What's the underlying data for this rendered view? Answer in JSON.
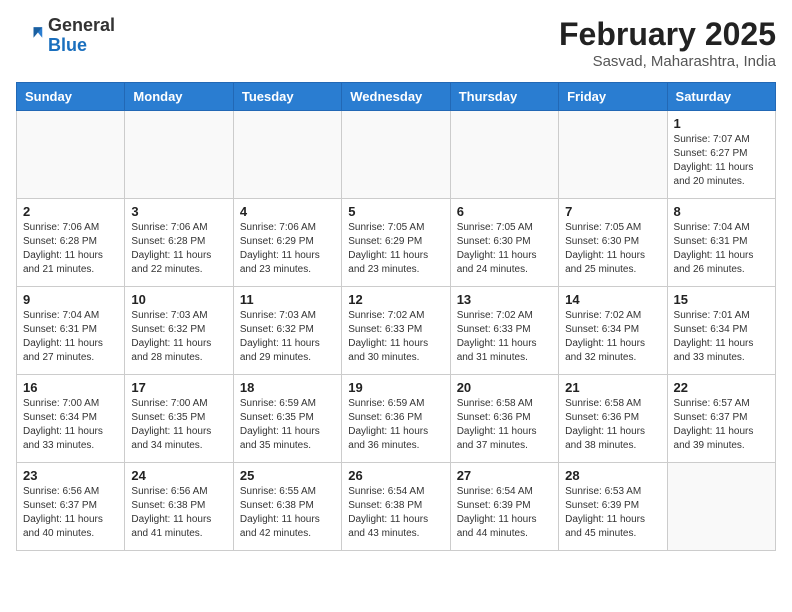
{
  "header": {
    "logo_general": "General",
    "logo_blue": "Blue",
    "month": "February 2025",
    "location": "Sasvad, Maharashtra, India"
  },
  "weekdays": [
    "Sunday",
    "Monday",
    "Tuesday",
    "Wednesday",
    "Thursday",
    "Friday",
    "Saturday"
  ],
  "weeks": [
    [
      {
        "day": "",
        "info": ""
      },
      {
        "day": "",
        "info": ""
      },
      {
        "day": "",
        "info": ""
      },
      {
        "day": "",
        "info": ""
      },
      {
        "day": "",
        "info": ""
      },
      {
        "day": "",
        "info": ""
      },
      {
        "day": "1",
        "info": "Sunrise: 7:07 AM\nSunset: 6:27 PM\nDaylight: 11 hours and 20 minutes."
      }
    ],
    [
      {
        "day": "2",
        "info": "Sunrise: 7:06 AM\nSunset: 6:28 PM\nDaylight: 11 hours and 21 minutes."
      },
      {
        "day": "3",
        "info": "Sunrise: 7:06 AM\nSunset: 6:28 PM\nDaylight: 11 hours and 22 minutes."
      },
      {
        "day": "4",
        "info": "Sunrise: 7:06 AM\nSunset: 6:29 PM\nDaylight: 11 hours and 23 minutes."
      },
      {
        "day": "5",
        "info": "Sunrise: 7:05 AM\nSunset: 6:29 PM\nDaylight: 11 hours and 23 minutes."
      },
      {
        "day": "6",
        "info": "Sunrise: 7:05 AM\nSunset: 6:30 PM\nDaylight: 11 hours and 24 minutes."
      },
      {
        "day": "7",
        "info": "Sunrise: 7:05 AM\nSunset: 6:30 PM\nDaylight: 11 hours and 25 minutes."
      },
      {
        "day": "8",
        "info": "Sunrise: 7:04 AM\nSunset: 6:31 PM\nDaylight: 11 hours and 26 minutes."
      }
    ],
    [
      {
        "day": "9",
        "info": "Sunrise: 7:04 AM\nSunset: 6:31 PM\nDaylight: 11 hours and 27 minutes."
      },
      {
        "day": "10",
        "info": "Sunrise: 7:03 AM\nSunset: 6:32 PM\nDaylight: 11 hours and 28 minutes."
      },
      {
        "day": "11",
        "info": "Sunrise: 7:03 AM\nSunset: 6:32 PM\nDaylight: 11 hours and 29 minutes."
      },
      {
        "day": "12",
        "info": "Sunrise: 7:02 AM\nSunset: 6:33 PM\nDaylight: 11 hours and 30 minutes."
      },
      {
        "day": "13",
        "info": "Sunrise: 7:02 AM\nSunset: 6:33 PM\nDaylight: 11 hours and 31 minutes."
      },
      {
        "day": "14",
        "info": "Sunrise: 7:02 AM\nSunset: 6:34 PM\nDaylight: 11 hours and 32 minutes."
      },
      {
        "day": "15",
        "info": "Sunrise: 7:01 AM\nSunset: 6:34 PM\nDaylight: 11 hours and 33 minutes."
      }
    ],
    [
      {
        "day": "16",
        "info": "Sunrise: 7:00 AM\nSunset: 6:34 PM\nDaylight: 11 hours and 33 minutes."
      },
      {
        "day": "17",
        "info": "Sunrise: 7:00 AM\nSunset: 6:35 PM\nDaylight: 11 hours and 34 minutes."
      },
      {
        "day": "18",
        "info": "Sunrise: 6:59 AM\nSunset: 6:35 PM\nDaylight: 11 hours and 35 minutes."
      },
      {
        "day": "19",
        "info": "Sunrise: 6:59 AM\nSunset: 6:36 PM\nDaylight: 11 hours and 36 minutes."
      },
      {
        "day": "20",
        "info": "Sunrise: 6:58 AM\nSunset: 6:36 PM\nDaylight: 11 hours and 37 minutes."
      },
      {
        "day": "21",
        "info": "Sunrise: 6:58 AM\nSunset: 6:36 PM\nDaylight: 11 hours and 38 minutes."
      },
      {
        "day": "22",
        "info": "Sunrise: 6:57 AM\nSunset: 6:37 PM\nDaylight: 11 hours and 39 minutes."
      }
    ],
    [
      {
        "day": "23",
        "info": "Sunrise: 6:56 AM\nSunset: 6:37 PM\nDaylight: 11 hours and 40 minutes."
      },
      {
        "day": "24",
        "info": "Sunrise: 6:56 AM\nSunset: 6:38 PM\nDaylight: 11 hours and 41 minutes."
      },
      {
        "day": "25",
        "info": "Sunrise: 6:55 AM\nSunset: 6:38 PM\nDaylight: 11 hours and 42 minutes."
      },
      {
        "day": "26",
        "info": "Sunrise: 6:54 AM\nSunset: 6:38 PM\nDaylight: 11 hours and 43 minutes."
      },
      {
        "day": "27",
        "info": "Sunrise: 6:54 AM\nSunset: 6:39 PM\nDaylight: 11 hours and 44 minutes."
      },
      {
        "day": "28",
        "info": "Sunrise: 6:53 AM\nSunset: 6:39 PM\nDaylight: 11 hours and 45 minutes."
      },
      {
        "day": "",
        "info": ""
      }
    ]
  ]
}
